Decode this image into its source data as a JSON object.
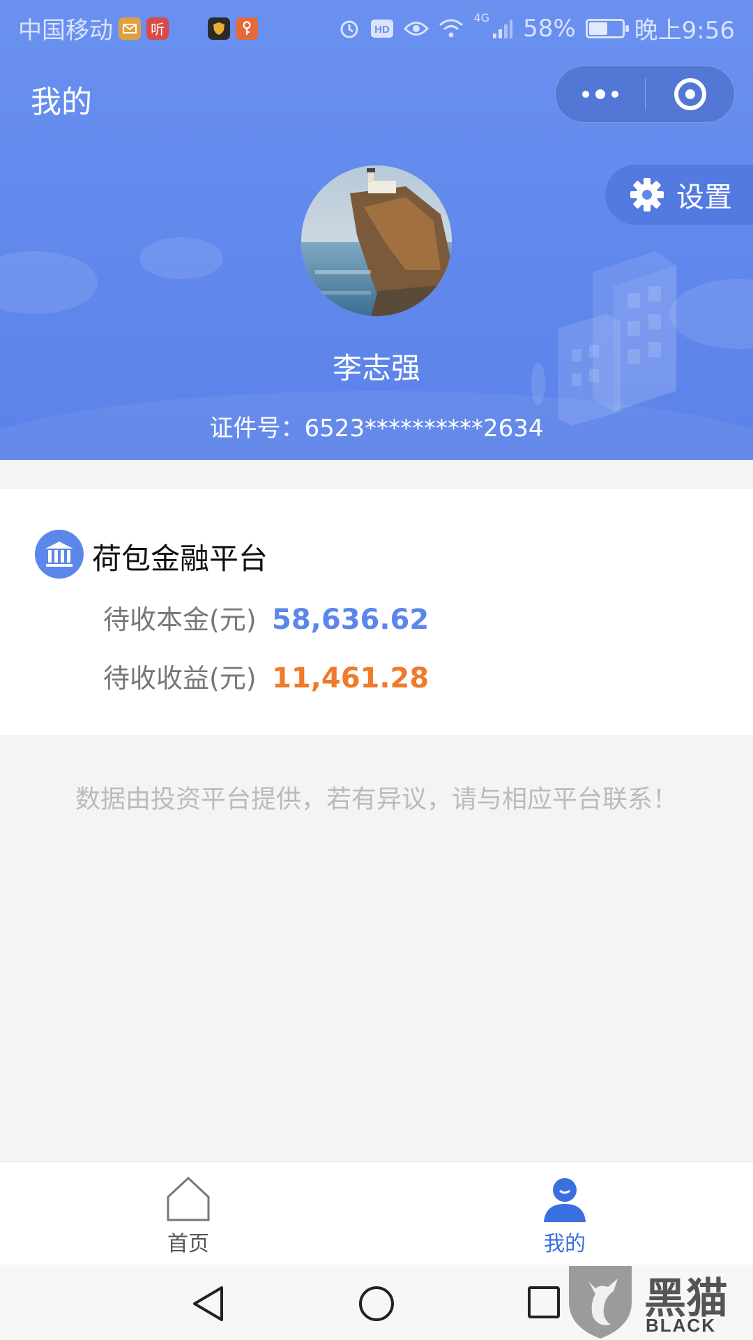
{
  "status_bar": {
    "carrier": "中国移动",
    "network": "4G",
    "battery": "58%",
    "battery_level": 0.58,
    "time": "晚上9:56",
    "app_icons": [
      "mail-icon",
      "listen-icon",
      "shield-app-icon",
      "key-app-icon"
    ],
    "app_icon_text": {
      "listen": "听"
    }
  },
  "header": {
    "title": "我的",
    "settings_label": "设置",
    "user_name": "李志强",
    "id_number": "证件号：6523**********2634"
  },
  "platform": {
    "name": "荷包金融平台",
    "principal_label": "待收本金(元)",
    "principal_value": "58,636.62",
    "income_label": "待收收益(元)",
    "income_value": "11,461.28"
  },
  "disclaimer": "数据由投资平台提供，若有异议，请与相应平台联系！",
  "tabbar": {
    "tabs": [
      {
        "label": "首页",
        "icon": "home-icon",
        "active": false
      },
      {
        "label": "我的",
        "icon": "user-icon",
        "active": true
      }
    ]
  },
  "watermark": {
    "title": "黑猫",
    "subtitle": "BLACK CAT"
  },
  "colors": {
    "header_blue": "#6a91f0",
    "principal_blue": "#5b86ea",
    "income_orange": "#f07a2a",
    "tab_active": "#3a6fe0"
  }
}
